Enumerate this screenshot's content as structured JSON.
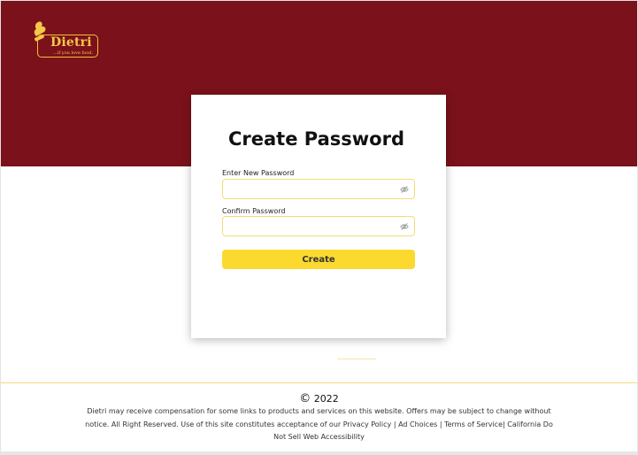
{
  "brand": {
    "name": "Dietri",
    "tagline": "...if you love food."
  },
  "colors": {
    "hero_background": "#7b111a",
    "accent_yellow": "#fbd92f",
    "field_border": "#f4dd74",
    "logo_gold": "#f3c94a"
  },
  "form": {
    "title": "Create Password",
    "new_password": {
      "label": "Enter New Password",
      "value": "",
      "placeholder": "",
      "icon": "eye-off-icon"
    },
    "confirm_password": {
      "label": "Confirm Password",
      "value": "",
      "placeholder": "",
      "icon": "eye-off-icon"
    },
    "submit_label": "Create"
  },
  "footer": {
    "copyright_symbol": "©",
    "year": "2022",
    "disclaimer": "Dietri may receive compensation for some links to products and services on this website. Offers may be subject to change without notice. All Right Reserved. Use of this site constitutes acceptance of our",
    "links": {
      "privacy": "Privacy Policy",
      "sep1": "|",
      "ad_choices": "Ad Choices",
      "sep2": "|",
      "terms": "Terms of Service|",
      "california": "California Do Not Sell",
      "accessibility": "Web Accessibility"
    }
  }
}
